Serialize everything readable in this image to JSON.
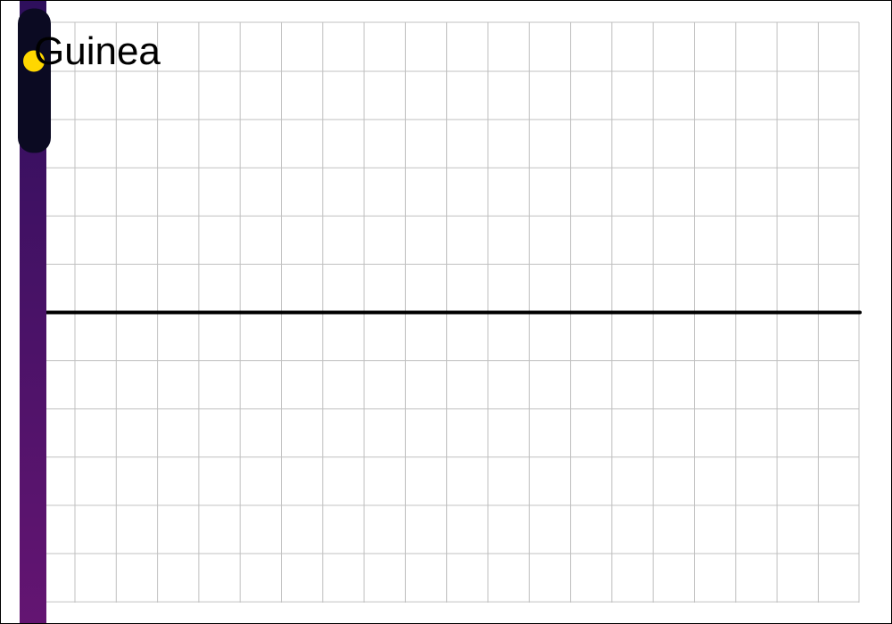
{
  "chart_data": {
    "type": "line",
    "title": "Guinea",
    "xlabel": "",
    "ylabel": "",
    "grid": true,
    "reference_line": {
      "y": 0
    },
    "ylim": [
      -6,
      6
    ],
    "xlim": [
      0,
      20
    ],
    "slider": {
      "fraction": 0.87
    },
    "colors": {
      "background": "#ffffff",
      "grid": "#c0c0c0",
      "reference_line": "#000000",
      "bar_top": "#2e0f5c",
      "bar_bottom": "#641572",
      "thumb": "#0b0a22",
      "knob": "#ffd700",
      "title": "#000000"
    }
  }
}
